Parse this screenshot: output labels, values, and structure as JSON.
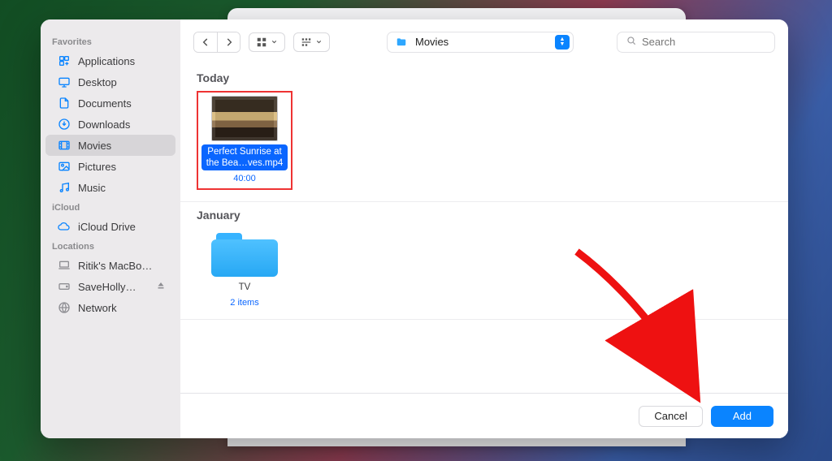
{
  "location": {
    "name": "Movies"
  },
  "search": {
    "placeholder": "Search",
    "value": ""
  },
  "sidebar": {
    "sections": [
      {
        "title": "Favorites",
        "items": [
          {
            "label": "Applications"
          },
          {
            "label": "Desktop"
          },
          {
            "label": "Documents"
          },
          {
            "label": "Downloads"
          },
          {
            "label": "Movies"
          },
          {
            "label": "Pictures"
          },
          {
            "label": "Music"
          }
        ]
      },
      {
        "title": "iCloud",
        "items": [
          {
            "label": "iCloud Drive"
          }
        ]
      },
      {
        "title": "Locations",
        "items": [
          {
            "label": "Ritik's MacBo…"
          },
          {
            "label": "SaveHolly…"
          },
          {
            "label": "Network"
          }
        ]
      }
    ]
  },
  "groups": [
    {
      "title": "Today",
      "items": [
        {
          "name": "Perfect Sunrise at the Bea…ves.mp4",
          "meta": "40:00",
          "kind": "video",
          "selected": true
        }
      ]
    },
    {
      "title": "January",
      "items": [
        {
          "name": "TV",
          "meta": "2 items",
          "kind": "folder",
          "selected": false
        }
      ]
    }
  ],
  "footer": {
    "cancel": "Cancel",
    "confirm": "Add"
  }
}
